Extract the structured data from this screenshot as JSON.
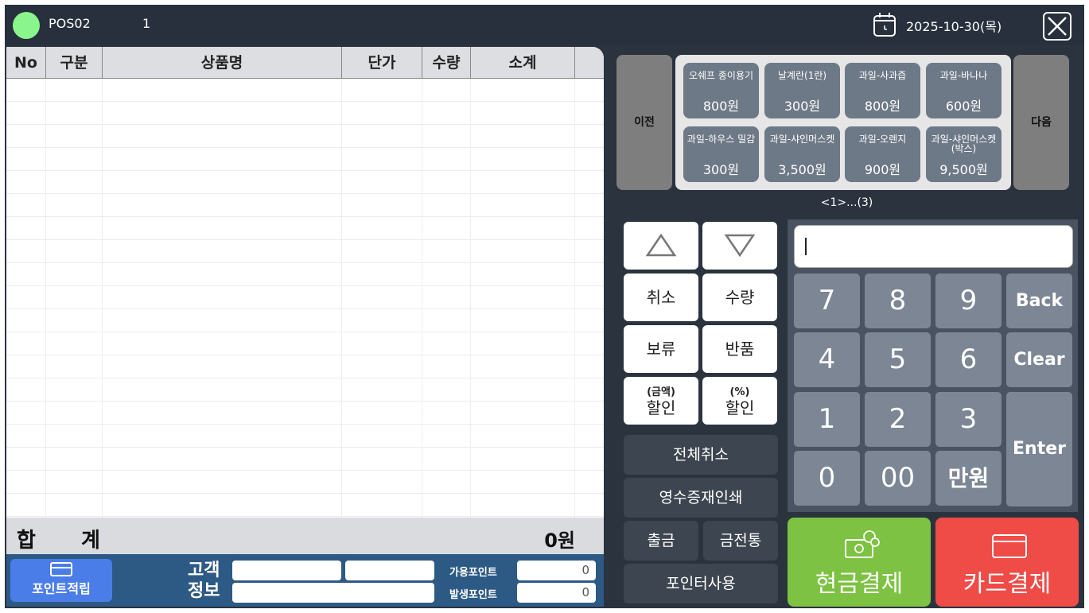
{
  "header": {
    "pos_name": "POS02",
    "pos_number": "1",
    "date": "2025-10-30(목)"
  },
  "table": {
    "columns": [
      "No",
      "구분",
      "상품명",
      "단가",
      "수량",
      "소계"
    ],
    "rows": []
  },
  "totals": {
    "label": "합 계",
    "value": "0원"
  },
  "customer": {
    "point_button_label": "포인트적립",
    "label_line1": "고객",
    "label_line2": "정보",
    "available_points_label": "가용포인트",
    "available_points_value": "0",
    "earned_points_label": "발생포인트",
    "earned_points_value": "0"
  },
  "products": {
    "prev_label": "이전",
    "next_label": "다음",
    "items": [
      {
        "name": "오쉐프 종이용기",
        "price": "800원"
      },
      {
        "name": "날계란(1란)",
        "price": "300원"
      },
      {
        "name": "과일-사과즙",
        "price": "800원"
      },
      {
        "name": "과일-바나나",
        "price": "600원"
      },
      {
        "name": "과일-하우스 밀감",
        "price": "300원"
      },
      {
        "name": "과일-샤인머스켓",
        "price": "3,500원"
      },
      {
        "name": "과일-오렌지",
        "price": "900원"
      },
      {
        "name": "과일-샤인머스켓(박스)",
        "price": "9,500원"
      }
    ],
    "pager": "<1>...(3)"
  },
  "actions": {
    "cancel": "취소",
    "quantity": "수량",
    "hold": "보류",
    "return": "반품",
    "amount_discount_top": "(금액)",
    "amount_discount_bottom": "할인",
    "percent_discount_top": "(%)",
    "percent_discount_bottom": "할인",
    "cancel_all": "전체취소",
    "reprint_receipt": "영수증재인쇄",
    "withdraw": "출금",
    "cash_drawer": "금전통",
    "use_points": "포인터사용"
  },
  "keypad": {
    "input_value": "",
    "keys": [
      "7",
      "8",
      "9",
      "4",
      "5",
      "6",
      "1",
      "2",
      "3",
      "0",
      "00",
      "만원"
    ],
    "back": "Back",
    "clear": "Clear",
    "enter": "Enter"
  },
  "payment": {
    "cash": "현금결제",
    "card": "카드결제"
  },
  "colors": {
    "status_online": "#8bf58d",
    "cash_button": "#7dc242",
    "card_button": "#ef4b47",
    "point_button": "#4b7de8",
    "customer_bar": "#2d5a85"
  }
}
